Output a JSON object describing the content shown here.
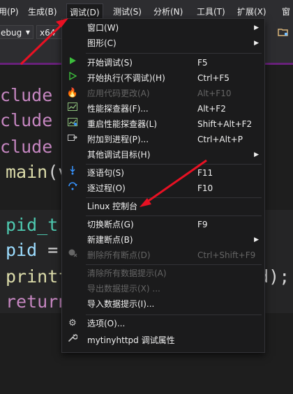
{
  "menubar": {
    "items": [
      {
        "label": "用(P)"
      },
      {
        "label": "生成(B)"
      },
      {
        "label": "调试(D)"
      },
      {
        "label": "测试(S)"
      },
      {
        "label": "分析(N)"
      },
      {
        "label": "工具(T)"
      },
      {
        "label": "扩展(X)"
      },
      {
        "label": "窗"
      }
    ]
  },
  "toolbar": {
    "config_value": "ebug",
    "platform_value": "x64"
  },
  "code": {
    "lines": [
      {
        "kw": "clude",
        "rest": " <"
      },
      {
        "kw": "clude",
        "rest": " <"
      },
      {
        "kw": "clude",
        "rest": " <"
      },
      {
        "fn": "main",
        "rest": "(v"
      },
      {
        "ty": "pid_t",
        "rest": ""
      },
      {
        "id": "pid",
        "rest": " ="
      },
      {
        "fn": "printf",
        "tail": "pid);"
      },
      {
        "kw": "return",
        "rest": ""
      }
    ]
  },
  "debug_menu": {
    "items": [
      {
        "label": "窗口(W)",
        "shortcut": "",
        "icon": "",
        "submenu": true,
        "enabled": true
      },
      {
        "label": "图形(C)",
        "shortcut": "",
        "icon": "",
        "submenu": true,
        "enabled": true
      },
      {
        "label": "开始调试(S)",
        "shortcut": "F5",
        "icon": "play-filled-icon",
        "submenu": false,
        "enabled": true
      },
      {
        "label": "开始执行(不调试)(H)",
        "shortcut": "Ctrl+F5",
        "icon": "play-outline-icon",
        "submenu": false,
        "enabled": true
      },
      {
        "label": "应用代码更改(A)",
        "shortcut": "Alt+F10",
        "icon": "flame-icon",
        "submenu": false,
        "enabled": false
      },
      {
        "label": "性能探查器(F)...",
        "shortcut": "Alt+F2",
        "icon": "profiler-icon",
        "submenu": false,
        "enabled": true
      },
      {
        "label": "重启性能探查器(L)",
        "shortcut": "Shift+Alt+F2",
        "icon": "profiler-restart-icon",
        "submenu": false,
        "enabled": true
      },
      {
        "label": "附加到进程(P)...",
        "shortcut": "Ctrl+Alt+P",
        "icon": "attach-process-icon",
        "submenu": false,
        "enabled": true
      },
      {
        "label": "其他调试目标(H)",
        "shortcut": "",
        "icon": "",
        "submenu": true,
        "enabled": true
      },
      {
        "label": "逐语句(S)",
        "shortcut": "F11",
        "icon": "step-into-icon",
        "submenu": false,
        "enabled": true
      },
      {
        "label": "逐过程(O)",
        "shortcut": "F10",
        "icon": "step-over-icon",
        "submenu": false,
        "enabled": true
      },
      {
        "label": "Linux 控制台",
        "shortcut": "",
        "icon": "",
        "submenu": false,
        "enabled": true
      },
      {
        "label": "切换断点(G)",
        "shortcut": "F9",
        "icon": "",
        "submenu": false,
        "enabled": true
      },
      {
        "label": "新建断点(B)",
        "shortcut": "",
        "icon": "",
        "submenu": true,
        "enabled": true
      },
      {
        "label": "删除所有断点(D)",
        "shortcut": "Ctrl+Shift+F9",
        "icon": "delete-breakpoints-icon",
        "submenu": false,
        "enabled": false
      },
      {
        "label": "清除所有数据提示(A)",
        "shortcut": "",
        "icon": "",
        "submenu": false,
        "enabled": false
      },
      {
        "label": "导出数据提示(X) ...",
        "shortcut": "",
        "icon": "",
        "submenu": false,
        "enabled": false
      },
      {
        "label": "导入数据提示(I)...",
        "shortcut": "",
        "icon": "",
        "submenu": false,
        "enabled": true
      },
      {
        "label": "选项(O)...",
        "shortcut": "",
        "icon": "gear-icon",
        "submenu": false,
        "enabled": true
      },
      {
        "label": "mytinyhttpd 调试属性",
        "shortcut": "",
        "icon": "wrench-icon",
        "submenu": false,
        "enabled": true
      }
    ]
  },
  "colors": {
    "annotation_arrow": "#e81123",
    "play_green": "#3cbc3c",
    "step_blue": "#3794ff"
  }
}
